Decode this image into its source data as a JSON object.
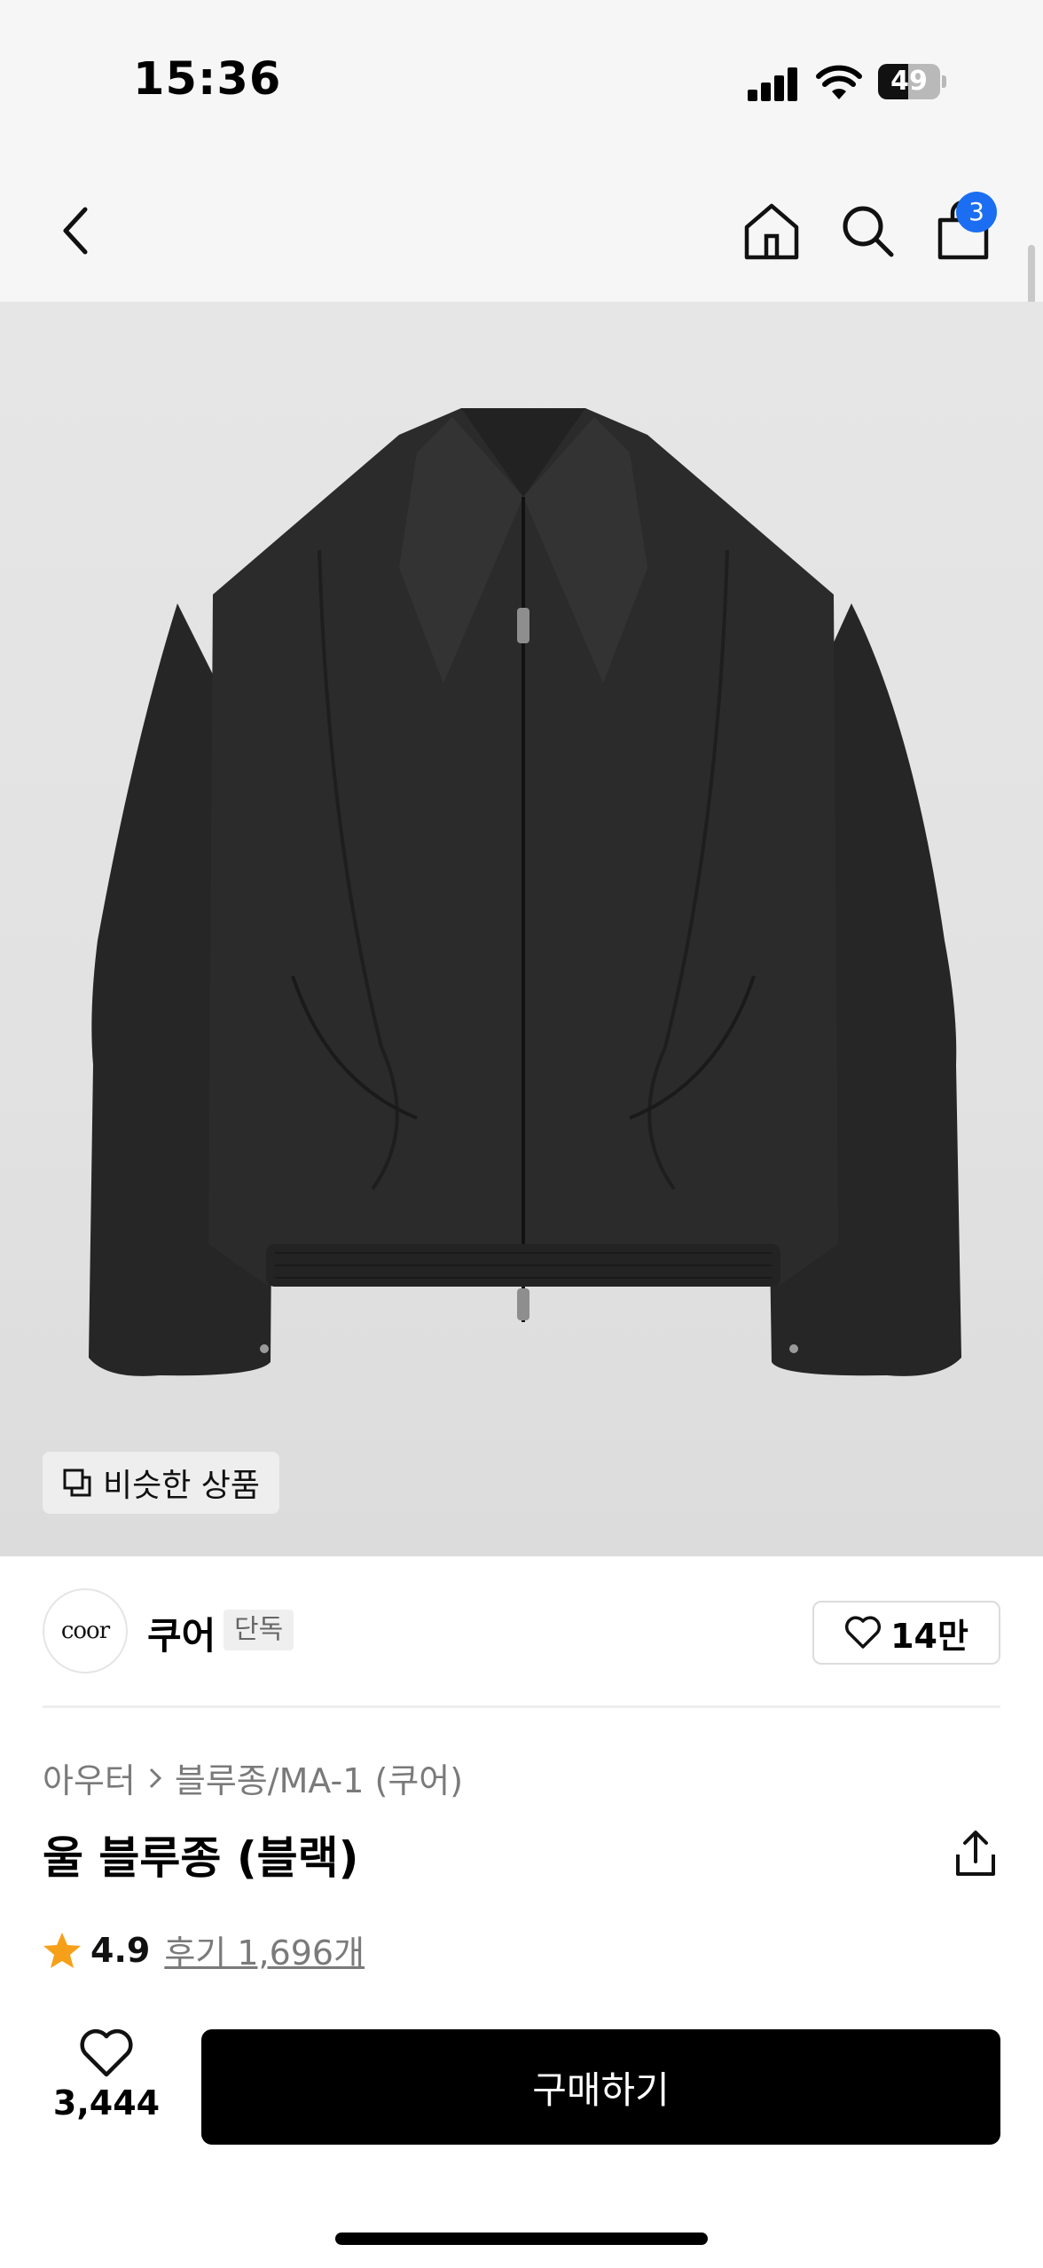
{
  "status_bar": {
    "time": "15:36",
    "battery": "49",
    "battery_level": 0.49
  },
  "nav": {
    "cart_count": "3"
  },
  "image": {
    "similar_label": "비슷한 상품"
  },
  "brand": {
    "logo_text": "coor",
    "name": "쿠어",
    "tag": "단독",
    "like_count": "14만"
  },
  "breadcrumb": {
    "category": "아우터",
    "subcategory": "블루종/MA-1 (쿠어)"
  },
  "product": {
    "title": "울 블루종 (블랙)"
  },
  "rating": {
    "score": "4.9",
    "reviews": "후기 1,696개"
  },
  "bottom_bar": {
    "wish_count": "3,444",
    "buy_label": "구매하기"
  },
  "colors": {
    "accent": "#1b6ef2",
    "star": "#f6a01a",
    "buy_bg": "#000000"
  }
}
